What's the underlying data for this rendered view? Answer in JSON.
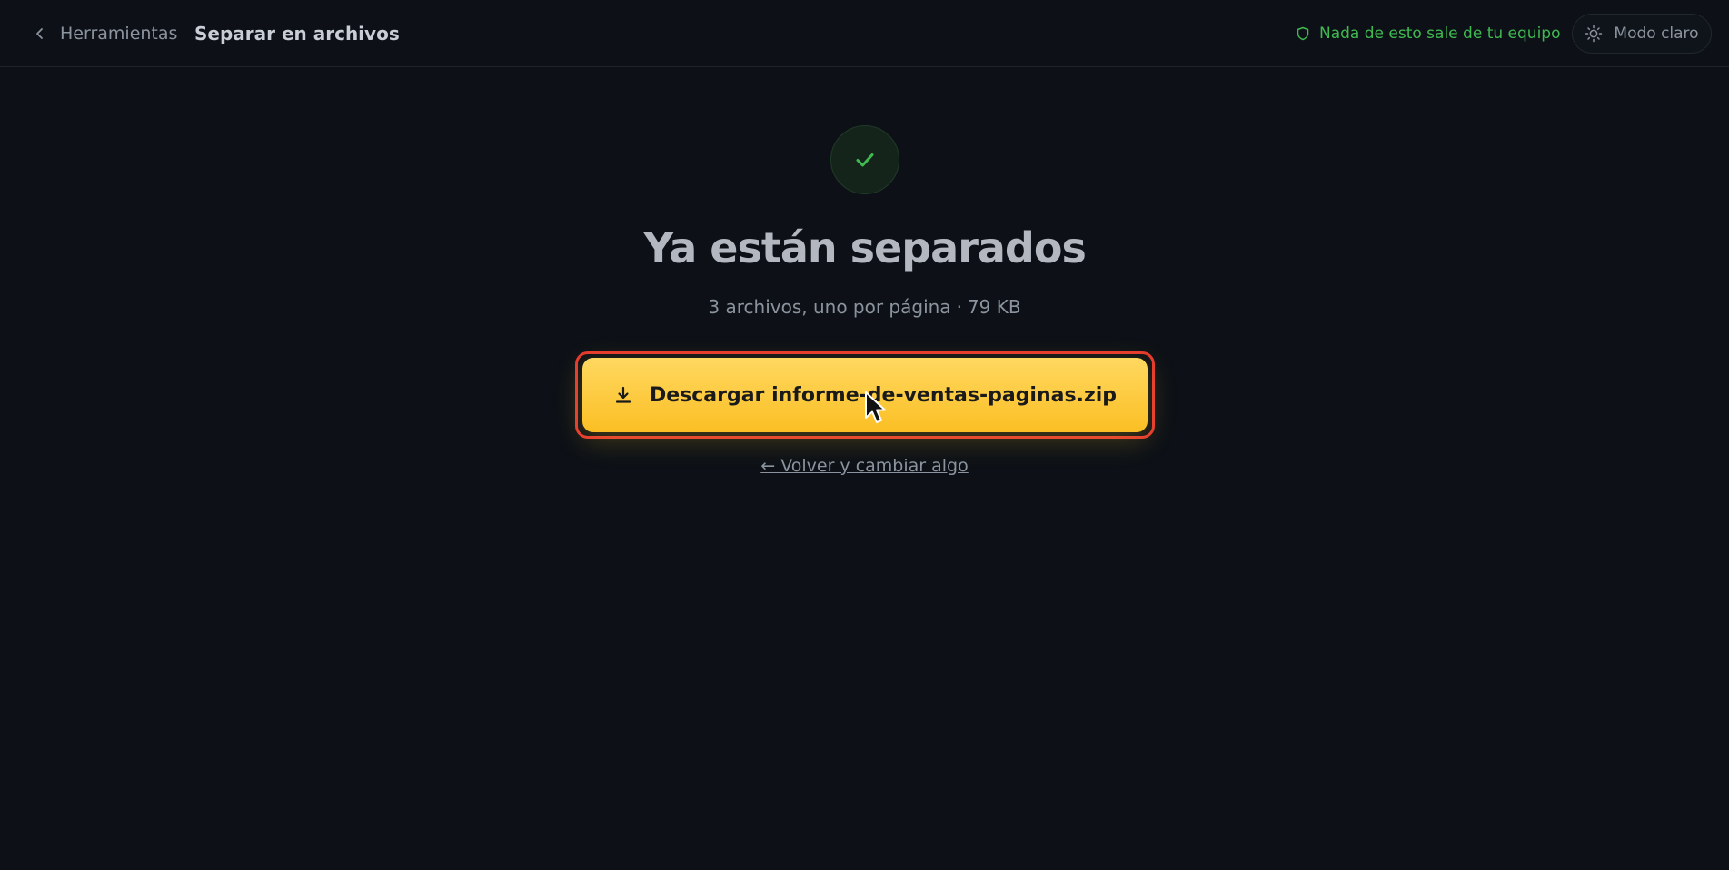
{
  "header": {
    "back_label": "Herramientas",
    "title": "Separar en archivos",
    "privacy_note": "Nada de esto sale de tu equipo",
    "theme_toggle_label": "Modo claro"
  },
  "result": {
    "headline": "Ya están separados",
    "summary": "3 archivos, uno por página",
    "separator": "·",
    "size": "79 KB",
    "download_label": "Descargar informe-de-ventas-paginas.zip",
    "back_link": "← Volver y cambiar algo"
  },
  "icons": {
    "back": "chevron-left-icon",
    "privacy": "shield-icon",
    "theme": "sun-icon",
    "success": "check-icon",
    "download": "download-icon"
  },
  "colors": {
    "background": "#0d1117",
    "accent": "#fbbf24",
    "success": "#3fb950",
    "highlight_outline": "#e5392f"
  }
}
